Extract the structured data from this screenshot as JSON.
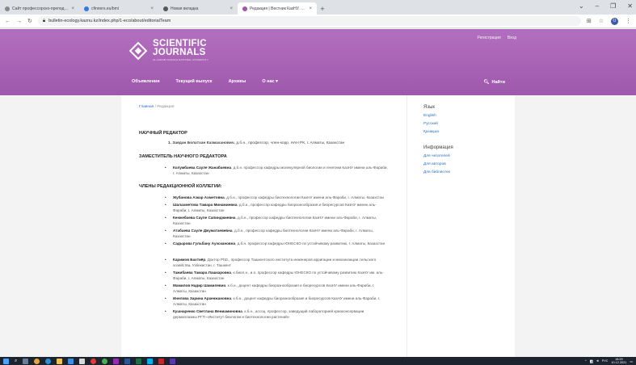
{
  "browser": {
    "tabs": [
      {
        "title": "Сайт профессорско-преподават",
        "active": false
      },
      {
        "title": "cfinners.eu/bmi",
        "active": false
      },
      {
        "title": "Новая вкладка",
        "active": false
      },
      {
        "title": "Редакция | Вестник КазНУ. Сер.",
        "active": true
      }
    ],
    "new_tab": "+",
    "url": "bulletin-ecology.kaznu.kz/index.php/1-eco/about/editorialTeam",
    "profile_initial": "O"
  },
  "header": {
    "user_links": [
      "Регистрация",
      "Вход"
    ],
    "logo_line1": "SCIENTIFIC",
    "logo_line2": "JOURNALS",
    "logo_sub": "AL-FARABI KAZAKH NATIONAL UNIVERSITY",
    "nav": [
      "Объявления",
      "Текущий выпуск",
      "Архивы",
      "О нас ▾"
    ],
    "search_label": "Найти"
  },
  "main": {
    "breadcrumb_home": "Главная",
    "breadcrumb_sep": "/",
    "breadcrumb_current": "Редакция",
    "sections": {
      "chief": {
        "title": "НАУЧНЫЙ РЕДАКТОР",
        "item_name": "1. Заядан Болатхан Казмаханович",
        "item_desc": ", д.б.н., профессор, член-корр. НАН РК, г. Алматы, Казахстан"
      },
      "deputy": {
        "title": "ЗАМЕСТИТЕЛЬ НАУЧНОГО РЕДАКТОРА",
        "item_name": "Колумбаева Сауле Жанабаевна",
        "item_desc": ", д.б.н. профессор кафедры молекулярной биологии и генетики КазНУ имени аль-Фараби, г. Алматы, Казахстан"
      },
      "board": {
        "title": "ЧЛЕНЫ РЕДАКЦИОННОЙ КОЛЛЕГИИ:",
        "members": [
          {
            "name": "Жубанова Азкар Ахметовна",
            "desc": ", д.б.н., профессор кафедры биотехнологии КазНУ имени аль-Фараби, г. Алматы, Казахстан"
          },
          {
            "name": "Шалахметова Тамара Минамиевна",
            "desc": ", д.б.н., профессор кафедры биоразнообразия и биоресурсов КазНУ имени аль-Фараби, г. Алматы, Казахстан"
          },
          {
            "name": "Кенжебаева Сауле Сапинджиевна",
            "desc": ", д.б.н., профессор кафедры биотехнологии КазНУ имени аль-Фараби, г. Алматы, Казахстан"
          },
          {
            "name": "Атабаева Сауле Джуматаевевна",
            "desc": ", д.б.н., профессор кафедры биотехнологии КазНУ имени аль-Фараби, г. Алматы, Казахстан"
          },
          {
            "name": "Садырова Гульбану Ауэскановна",
            "desc": ", д.б.н. профессор кафедры ЮНЕСКО по устойчивому развитию, г. Алматы, Казахстан"
          }
        ],
        "members2": [
          {
            "name": "Каримов Бахтиёр",
            "desc": ", Доктор PhD., профессор Ташкентского института инженеров ирригации и механизации сельского хозяйства, Узбекистан, г. Ташкент"
          },
          {
            "name": "Тажибаева Тамара Лашкаровна",
            "desc": ", к.биол.н., и.о. профессор кафедры ЮНЕСКО по устойчивому развитию КазНУ им. аль-Фараби, г. Алматы, Казахстан"
          },
          {
            "name": "Мамилов Надир Шамилевич",
            "desc": ", к.б.н., доцент кафедры биоразнообразия и биоресурсов КазНУ имени аль-Фараби, г. Алматы, Казахстан"
          },
          {
            "name": "Инелова Зарина Архенжановна",
            "desc": ", к.б.н., доцент кафедры биоразнообразия и биоресурсов КазНУ имени аль-Фараби, г. Алматы, Казахстан"
          },
          {
            "name": "Кушнаренко Светлана Вениаминовна",
            "desc": ", к.б.н., ассоц. профессор, заведущий лабораторией криоконсервации дермаплазмы РГП «Институт биологии и биотехнологии растений»"
          }
        ]
      }
    }
  },
  "sidebar": {
    "language_title": "Язык",
    "languages": [
      "English",
      "Русский",
      "Қазақша"
    ],
    "info_title": "Информация",
    "info_links": [
      "Для читателей",
      "Для авторов",
      "Для библиотек"
    ]
  },
  "taskbar": {
    "lang": "РУС",
    "time": "16:29",
    "date": "10.12.2021"
  }
}
